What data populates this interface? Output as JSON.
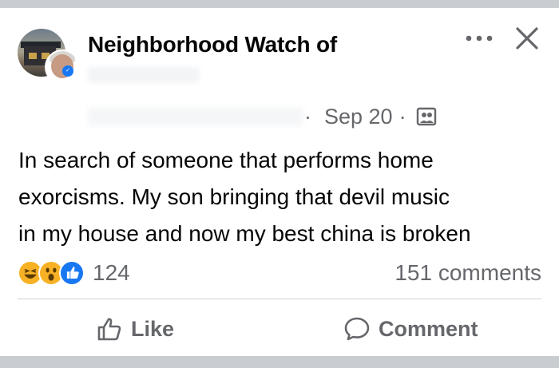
{
  "post": {
    "group_name": "Neighborhood Watch of",
    "date": "Sep 20",
    "separator": "·",
    "text_lines": [
      "In search of someone that performs home",
      "exorcisms. My son bringing that devil music",
      "in my house and now my best china is broken"
    ]
  },
  "engagement": {
    "reaction_count": "124",
    "comments_label": "151 comments"
  },
  "actions": {
    "like_label": "Like",
    "comment_label": "Comment"
  },
  "colors": {
    "facebook_blue": "#1877f2",
    "secondary_text": "#65676b",
    "reaction_yellow": "#f7b125"
  },
  "icons": [
    "more-options-icon",
    "close-icon",
    "group-photo-icon",
    "haha-reaction-icon",
    "wow-reaction-icon",
    "like-reaction-icon",
    "thumbs-up-icon",
    "comment-bubble-icon"
  ]
}
